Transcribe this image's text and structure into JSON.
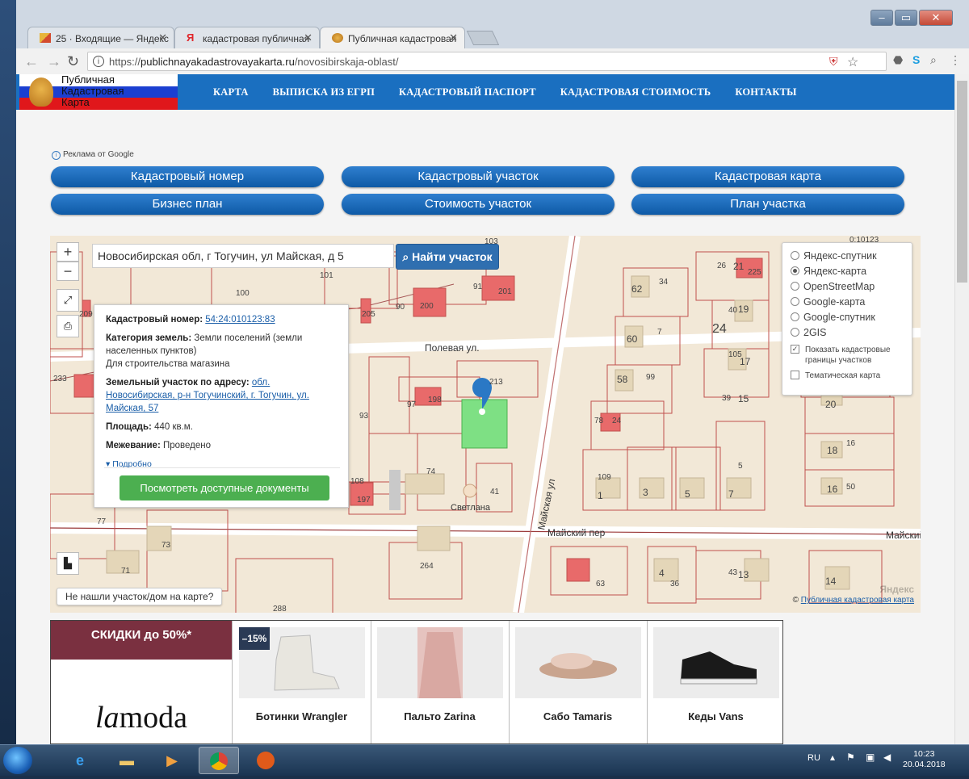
{
  "browser": {
    "tabs": [
      {
        "title": "25 · Входящие — Яндекс",
        "icon": "mail-icon"
      },
      {
        "title": "кадастровая публичная",
        "icon": "yandex-icon"
      },
      {
        "title": "Публичная кадастровая",
        "icon": "emblem-icon"
      }
    ],
    "url_prefix": "https://",
    "url_domain": "publichnayakadastrovayakarta.ru",
    "url_path": "/novosibirskaja-oblast/"
  },
  "site": {
    "logo_lines": [
      "Публичная",
      "Кадастровая",
      "Карта"
    ],
    "nav": [
      "КАРТА",
      "ВЫПИСКА ИЗ ЕГРП",
      "КАДАСТРОВЫЙ ПАСПОРТ",
      "КАДАСТРОВАЯ СТОИМОСТЬ",
      "КОНТАКТЫ"
    ],
    "ad_label": "Реклама от Google",
    "pill_buttons": [
      "Кадастровый номер",
      "Кадастровый участок",
      "Кадастровая карта",
      "Бизнес план",
      "Стоимость участок",
      "План участка"
    ]
  },
  "map": {
    "search_value": "Новосибирская обл, г Тогучин, ул Майская, д 5",
    "search_button": "Найти участок",
    "zoom_in": "+",
    "zoom_out": "−",
    "popup": {
      "cad_label": "Кадастровый номер:",
      "cad_value": "54:24:010123:83",
      "category_label": "Категория земель:",
      "category_value": "Земли поселений (земли населенных пунктов)",
      "category_use": "Для строительства магазина",
      "address_label": "Земельный участок по адресу:",
      "address_value": "обл. Новосибирская, р-н Тогучинский, г. Тогучин, ул. Майская, 57",
      "area_label": "Площадь:",
      "area_value": "440 кв.м.",
      "survey_label": "Межевание:",
      "survey_value": "Проведено",
      "more": "Подробно",
      "docs_button": "Посмотреть доступные документы"
    },
    "layers": [
      "Яндекс-спутник",
      "Яндекс-карта",
      "OpenStreetMap",
      "Google-карта",
      "Google-спутник",
      "2GIS"
    ],
    "layer_selected": 1,
    "check_borders": "Показать кадастровые границы участков",
    "check_thematic": "Тематическая карта",
    "not_found": "Не нашли участок/дом на карте?",
    "copyright_symbol": "©",
    "copyright_link": "Публичная кадастровая карта",
    "yandex_mark": "Яндекс",
    "street_labels": [
      "Полевая ул.",
      "Майская ул",
      "Майский пер",
      "Майский"
    ],
    "poi_label": "Светлана",
    "parcel_numbers": [
      "103",
      "101",
      "100",
      "91",
      "201",
      "90",
      "200",
      "205",
      "209",
      "233",
      "213",
      "97",
      "198",
      "93",
      "74",
      "108",
      "197",
      "41",
      "77",
      "73",
      "71",
      "264",
      "288",
      "62",
      "34",
      "26",
      "21",
      "225",
      "60",
      "7",
      "40",
      "19",
      "24",
      "105",
      "17",
      "58",
      "99",
      "39",
      "15",
      "20",
      "78",
      "24",
      "18",
      "16",
      "109",
      "1",
      "3",
      "5",
      "7",
      "5",
      "16",
      "50",
      "63",
      "4",
      "36",
      "43",
      "13",
      "14",
      "0:10123"
    ]
  },
  "ad": {
    "promo": "СКИДКИ до 50%*",
    "logo_italic": "la",
    "logo_rest": "moda",
    "discount": "–15%",
    "products": [
      "Ботинки Wrangler",
      "Пальто Zarina",
      "Сабо Tamaris",
      "Кеды Vans"
    ]
  },
  "taskbar": {
    "lang": "RU",
    "time": "10:23",
    "date": "20.04.2018"
  }
}
